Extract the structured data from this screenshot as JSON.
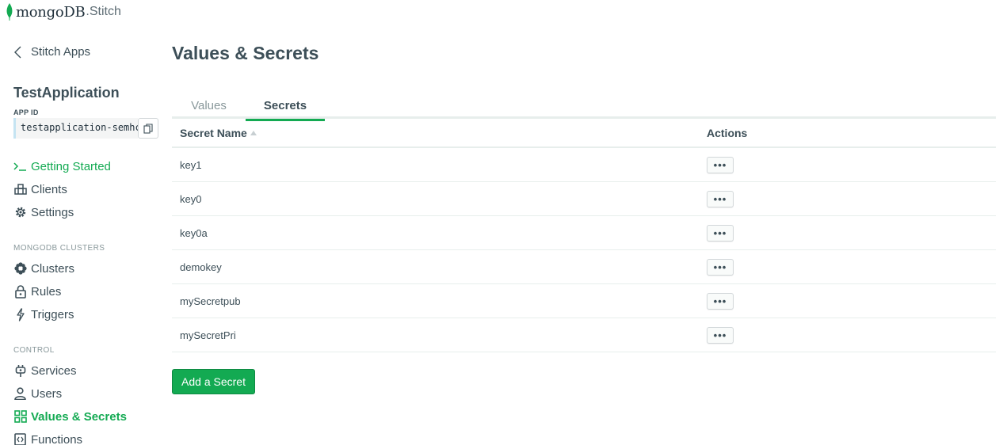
{
  "logo": {
    "brand": "mongoDB",
    "product": ".Stitch",
    "icon": "mongodb-leaf-icon",
    "color": "#13aa52"
  },
  "sidebar": {
    "back_label": "Stitch Apps",
    "app_name": "TestApplication",
    "app_id_label": "APP ID",
    "app_id_value": "testapplication-semhc",
    "top_items": [
      {
        "label": "Getting Started",
        "icon": "terminal-icon",
        "active": true
      },
      {
        "label": "Clients",
        "icon": "clients-icon",
        "active": false
      },
      {
        "label": "Settings",
        "icon": "gear-icon",
        "active": false
      }
    ],
    "clusters_section": "MONGODB CLUSTERS",
    "cluster_items": [
      {
        "label": "Clusters",
        "icon": "clusters-icon"
      },
      {
        "label": "Rules",
        "icon": "lock-icon"
      },
      {
        "label": "Triggers",
        "icon": "lightning-icon"
      }
    ],
    "control_section": "CONTROL",
    "control_items": [
      {
        "label": "Services",
        "icon": "plug-icon",
        "active": false
      },
      {
        "label": "Users",
        "icon": "user-icon",
        "active": false
      },
      {
        "label": "Values & Secrets",
        "icon": "grid-icon",
        "active": true
      },
      {
        "label": "Functions",
        "icon": "function-icon",
        "active": false
      }
    ]
  },
  "main": {
    "title": "Values & Secrets",
    "tabs": [
      {
        "label": "Values",
        "active": false
      },
      {
        "label": "Secrets",
        "active": true
      }
    ],
    "table": {
      "columns": [
        "Secret Name",
        "Actions"
      ],
      "rows": [
        "key1",
        "key0",
        "key0a",
        "demokey",
        "mySecretpub",
        "mySecretPri"
      ],
      "action_label": "•••"
    },
    "add_button": "Add a Secret"
  },
  "colors": {
    "accent": "#13aa52",
    "text": "#3d4f58",
    "muted": "#89989b"
  }
}
